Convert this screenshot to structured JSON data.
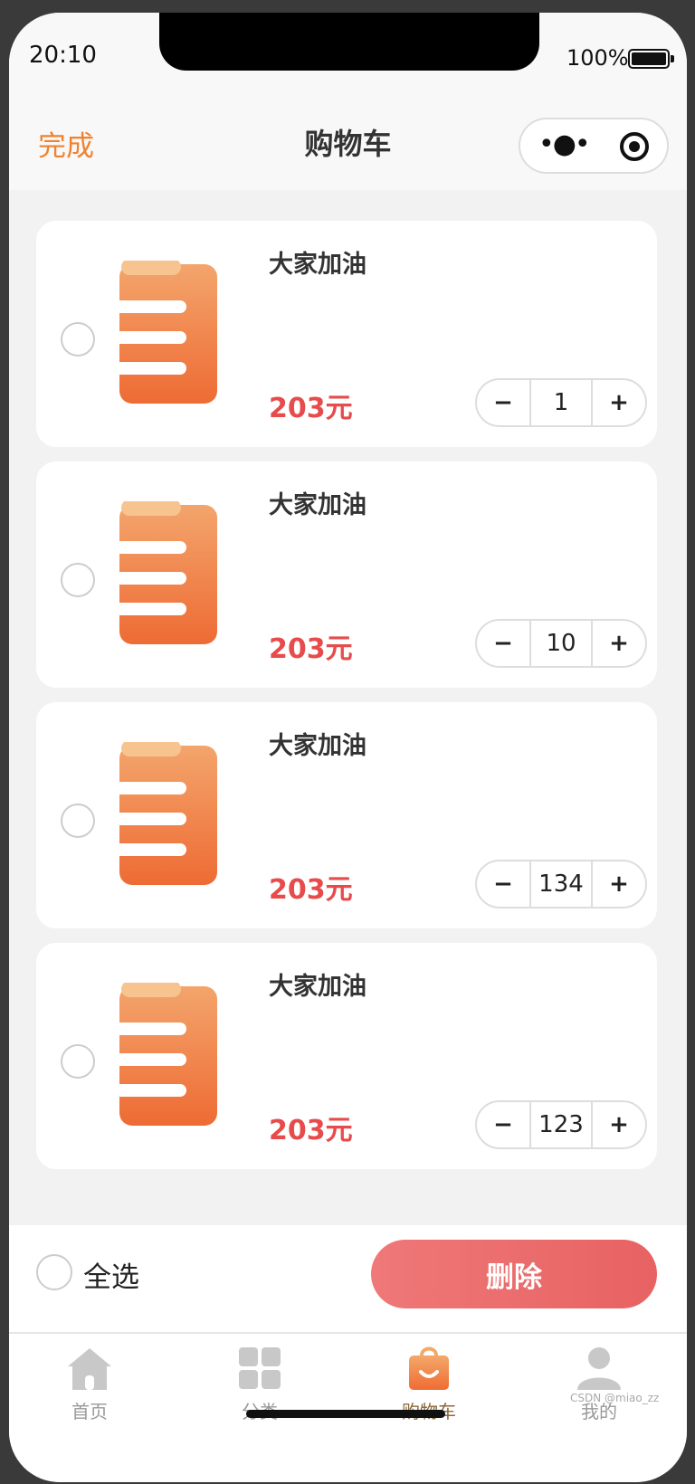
{
  "status": {
    "time": "20:10",
    "battery": "100%"
  },
  "nav": {
    "done_label": "完成",
    "title": "购物车"
  },
  "colors": {
    "accent": "#f0822f",
    "price": "#e74b4b",
    "delete": "#ec6a6a",
    "active_tab": "#8a6b3c"
  },
  "cart": {
    "items": [
      {
        "name": "大家加油",
        "price": "203元",
        "qty": "1",
        "minus": "−",
        "plus": "+"
      },
      {
        "name": "大家加油",
        "price": "203元",
        "qty": "10",
        "minus": "−",
        "plus": "+"
      },
      {
        "name": "大家加油",
        "price": "203元",
        "qty": "134",
        "minus": "−",
        "plus": "+"
      },
      {
        "name": "大家加油",
        "price": "203元",
        "qty": "123",
        "minus": "−",
        "plus": "+"
      }
    ],
    "select_all_label": "全选",
    "delete_label": "删除"
  },
  "tabs": [
    {
      "label": "首页",
      "icon": "home-icon"
    },
    {
      "label": "分类",
      "icon": "category-icon"
    },
    {
      "label": "购物车",
      "icon": "cart-bag-icon",
      "active": true
    },
    {
      "label": "我的",
      "icon": "profile-icon"
    }
  ],
  "watermark": "CSDN @miao_zz"
}
